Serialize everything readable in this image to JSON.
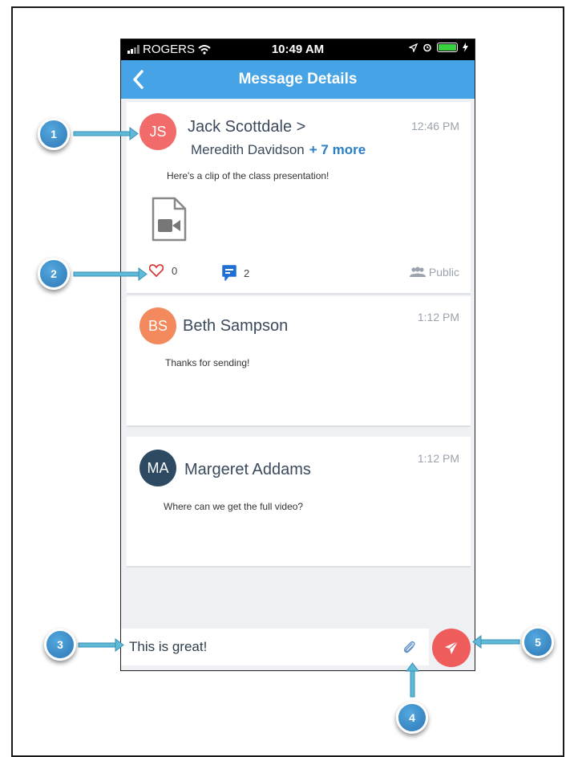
{
  "status_bar": {
    "carrier": "ROGERS",
    "time": "10:49 AM"
  },
  "header": {
    "title": "Message Details"
  },
  "messages": [
    {
      "initials": "JS",
      "sender": "Jack Scottdale  >",
      "recipients": "Meredith Davidson",
      "more": "+ 7 more",
      "time": "12:46 PM",
      "text": "Here's a clip of the class presentation!",
      "avatar_color": "#f26b6b",
      "likes": "0",
      "comments": "2",
      "visibility": "Public"
    },
    {
      "initials": "BS",
      "sender": "Beth Sampson",
      "time": "1:12 PM",
      "text": "Thanks for sending!",
      "avatar_color": "#f28a5e"
    },
    {
      "initials": "MA",
      "sender": "Margeret Addams",
      "time": "1:12 PM",
      "text": "Where can we get the full video?",
      "avatar_color": "#2e4a63"
    }
  ],
  "composer": {
    "value": "This is great!"
  },
  "callouts": [
    "1",
    "2",
    "3",
    "4",
    "5"
  ],
  "colors": {
    "nav": "#46a3e5",
    "send": "#ef5c5c",
    "callout": "#3b8ccc",
    "comment": "#1f6fd6"
  }
}
